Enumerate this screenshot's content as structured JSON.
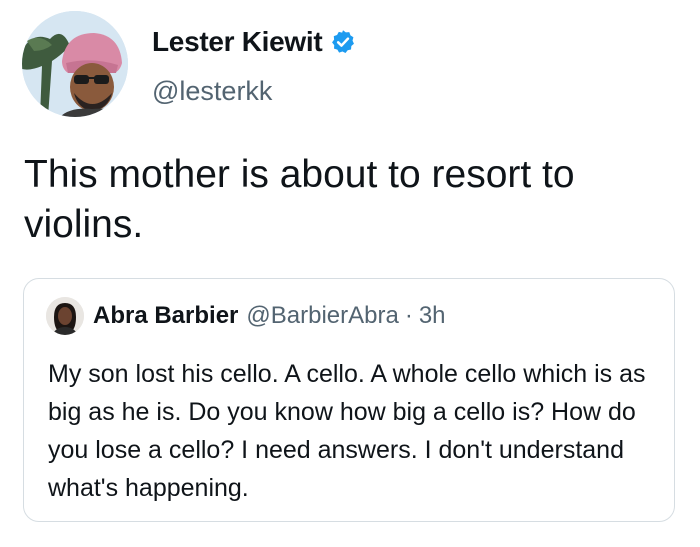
{
  "author": {
    "display_name": "Lester Kiewit",
    "handle": "@lesterkk",
    "verified": true,
    "avatar_icon": "profile-photo"
  },
  "tweet": {
    "text": "This mother is about to resort to violins."
  },
  "quoted_tweet": {
    "display_name": "Abra Barbier",
    "handle": "@BarbierAbra",
    "separator": "·",
    "time": "3h",
    "avatar_icon": "profile-photo",
    "text": "My son lost his cello. A cello. A whole cello which is as big as he is. Do you know how big a cello is? How do you lose a cello? I need answers. I don't understand what's happening."
  },
  "colors": {
    "text": "#0f1419",
    "secondary_text": "#536471",
    "verified_badge": "#1d9bf0",
    "card_border": "#d6dde2"
  }
}
